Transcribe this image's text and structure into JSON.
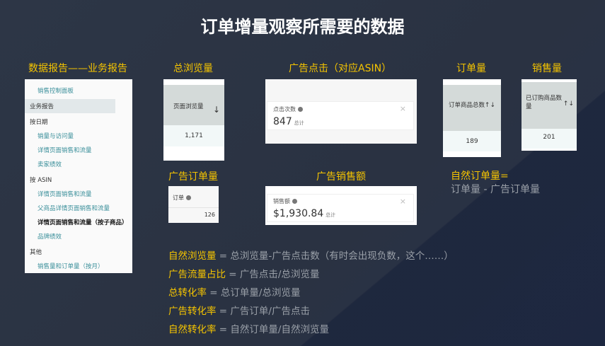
{
  "title": "订单增量观察所需要的数据",
  "labels": {
    "report": "数据报告——业务报告",
    "pageviews": "总浏览量",
    "clicks": "广告点击（对应ASIN）",
    "orders": "订单量",
    "units": "销售量",
    "ad_orders": "广告订单量",
    "ad_sales": "广告销售额",
    "organic_orders": "自然订单量=",
    "organic_orders_formula": "订单量 - 广告订单量"
  },
  "sidebar": {
    "items": [
      {
        "label": "销售控制面板",
        "type": "link"
      },
      {
        "label": "业务报告",
        "type": "selected"
      },
      {
        "label": "按日期",
        "type": "heading"
      },
      {
        "label": "销量与访问量",
        "type": "link"
      },
      {
        "label": "详情页面销售和流量",
        "type": "link"
      },
      {
        "label": "卖家绩效",
        "type": "link"
      },
      {
        "label": "按 ASIN",
        "type": "heading"
      },
      {
        "label": "详情页面销售和流量",
        "type": "link"
      },
      {
        "label": "父商品详情页面销售和流量",
        "type": "link"
      },
      {
        "label": "详情页面销售和流量（按子商品）",
        "type": "current"
      },
      {
        "label": "品牌绩效",
        "type": "link"
      },
      {
        "label": "其他",
        "type": "heading"
      },
      {
        "label": "销售量和订单量（按月）",
        "type": "link"
      }
    ]
  },
  "pageviews": {
    "header": "页面浏览量",
    "value": "1,171"
  },
  "clicks": {
    "header": "点击次数",
    "value": "847",
    "suffix": "总计"
  },
  "orders": {
    "header": "订单商品总数",
    "value": "189"
  },
  "units": {
    "header": "已订购商品数量",
    "value": "201"
  },
  "ad_orders": {
    "header": "订单",
    "value": "126"
  },
  "ad_sales": {
    "header": "销售额",
    "value": "$1,930.84",
    "suffix": "总计"
  },
  "formulas": [
    {
      "name": "自然浏览量",
      "expr": " = 总浏览量-广告点击数（有时会出现负数，这个……）"
    },
    {
      "name": "广告流量占比",
      "expr": " = 广告点击/总浏览量"
    },
    {
      "name": "总转化率",
      "expr": " = 总订单量/总浏览量"
    },
    {
      "name": "广告转化率",
      "expr": " = 广告订单/广告点击"
    },
    {
      "name": "自然转化率",
      "expr": " = 自然订单量/自然浏览量"
    }
  ]
}
